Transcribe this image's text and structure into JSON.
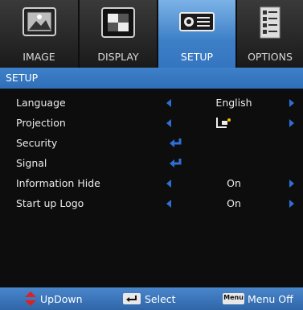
{
  "tabs": [
    {
      "label": "IMAGE",
      "icon": "picture-icon"
    },
    {
      "label": "DISPLAY",
      "icon": "display-icon"
    },
    {
      "label": "SETUP",
      "icon": "projector-icon",
      "active": true
    },
    {
      "label": "OPTIONS",
      "icon": "options-checklist-icon"
    }
  ],
  "section_title": "SETUP",
  "menu": [
    {
      "label": "Language",
      "value": "English"
    },
    {
      "label": "Projection",
      "value": ""
    },
    {
      "label": "Security",
      "value": ""
    },
    {
      "label": "Signal",
      "value": ""
    },
    {
      "label": "Information Hide",
      "value": "On"
    },
    {
      "label": "Start up Logo",
      "value": "On"
    }
  ],
  "footer": {
    "updown": "UpDown",
    "select": "Select",
    "menu_key": "Menu",
    "menu_off": "Menu Off"
  },
  "colors": {
    "accent_blue": "#3475bf",
    "arrow_blue": "#2e6fd6",
    "updown_red": "#e02020"
  }
}
